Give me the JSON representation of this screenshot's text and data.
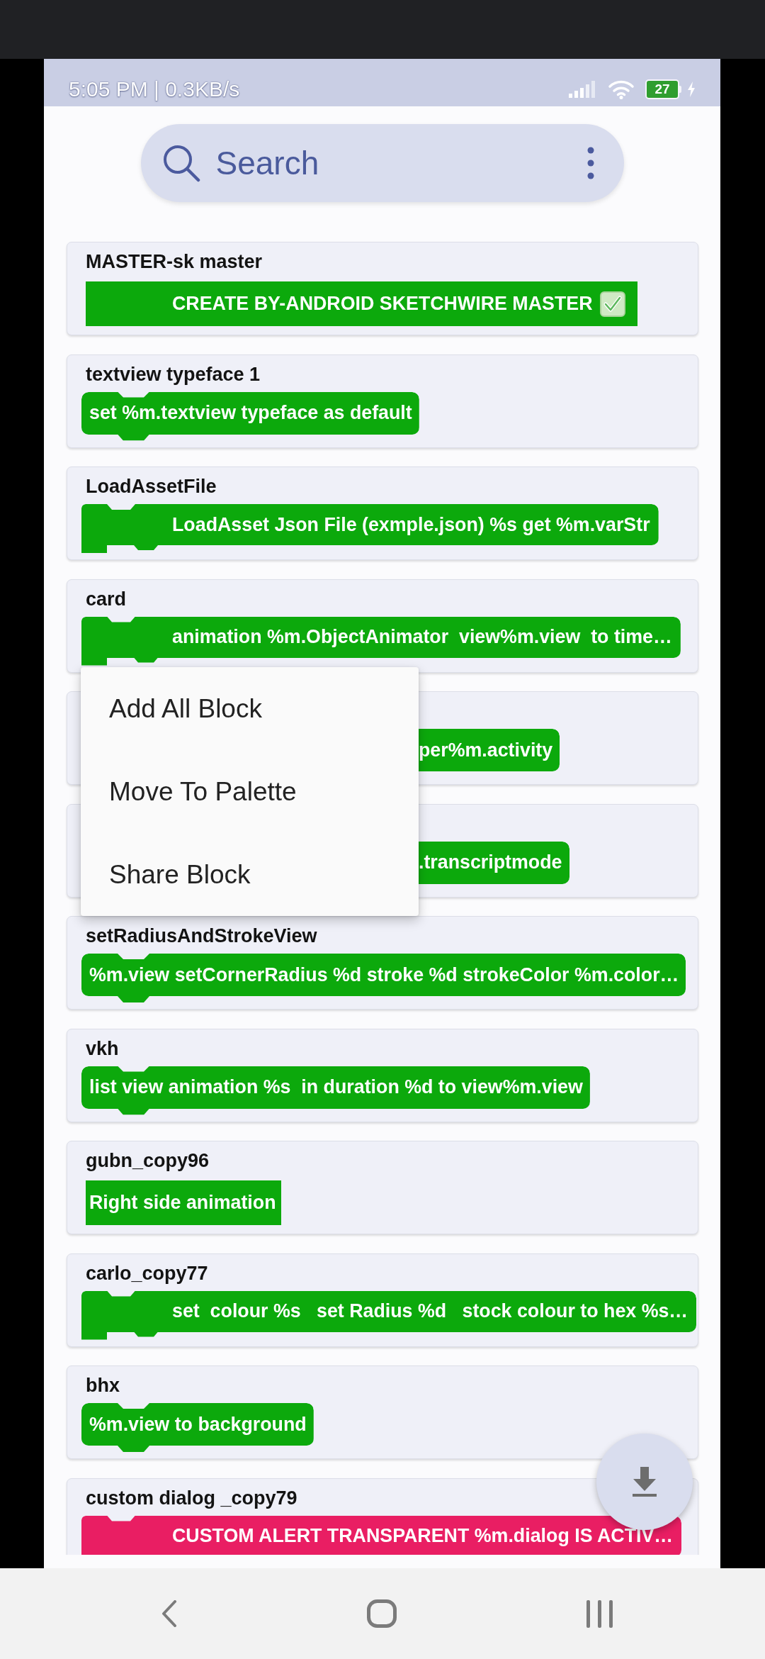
{
  "status_bar": {
    "text": "5:05 PM | 0.3KB/s",
    "battery": "27"
  },
  "search": {
    "placeholder": "Search"
  },
  "blocks": [
    {
      "title": "MASTER-sk master",
      "kind": "banner",
      "text": "CREATE BY-ANDROID SKETCHWIRE MASTER",
      "verified": true,
      "color": "#0ca90c"
    },
    {
      "title": "textview typeface 1",
      "kind": "statement",
      "text": "set %m.textview typeface as default",
      "verified": false,
      "color": "#0ca90c"
    },
    {
      "title": "LoadAssetFile",
      "kind": "wrap",
      "text": "LoadAsset Json File (exmple.json) %s get %m.varStr",
      "verified": false,
      "color": "#0ca90c"
    },
    {
      "title": "card",
      "kind": "wrap",
      "text": "animation %m.ObjectAnimator  view%m.view  to time…",
      "verified": false,
      "color": "#0ca90c"
    },
    {
      "kind": "statement",
      "text": "per%m.activity",
      "verified": false,
      "color": "#0ca90c"
    },
    {
      "kind": "statement",
      "text": ".transcriptmode",
      "verified": false,
      "color": "#0ca90c"
    },
    {
      "title": "setRadiusAndStrokeView",
      "kind": "statement",
      "text": "%m.view setCornerRadius %d stroke %d strokeColor %m.color…",
      "verified": false,
      "color": "#0ca90c"
    },
    {
      "title": "vkh",
      "kind": "statement",
      "text": "list view animation %s  in duration %d to view%m.view",
      "verified": false,
      "color": "#0ca90c"
    },
    {
      "title": "gubn_copy96",
      "kind": "plain",
      "text": "Right side animation",
      "verified": false,
      "color": "#0ca90c"
    },
    {
      "title": "carlo_copy77",
      "kind": "wrap",
      "text": "set  colour %s   set Radius %d   stock colour to hex %s…",
      "verified": false,
      "color": "#0ca90c"
    },
    {
      "title": "bhx",
      "kind": "statement",
      "text": "%m.view to background",
      "verified": false,
      "color": "#0ca90c"
    },
    {
      "title": "custom dialog _copy79",
      "kind": "wrap",
      "text": "CUSTOM ALERT TRANSPARENT %m.dialog IS ACTIV…",
      "verified": false,
      "color": "#e91e63"
    }
  ],
  "menu": {
    "items": [
      "Add All Block",
      "Move To Palette",
      "Share Block"
    ]
  }
}
